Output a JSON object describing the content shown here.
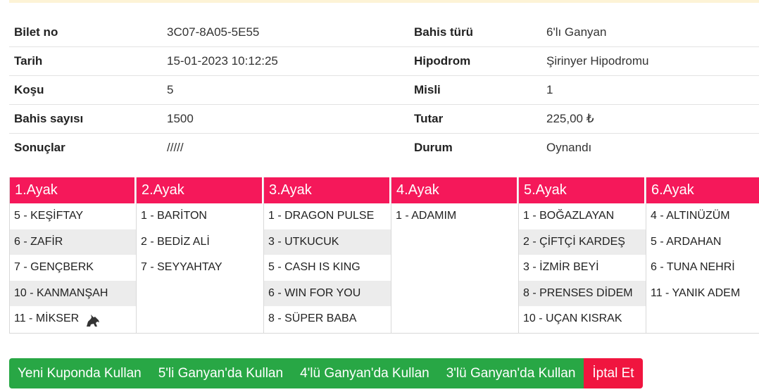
{
  "ticket": {
    "rows": [
      {
        "label1": "Bilet no",
        "value1": "3C07-8A05-5E55",
        "label2": "Bahis türü",
        "value2": "6'lı Ganyan"
      },
      {
        "label1": "Tarih",
        "value1": "15-01-2023 10:12:25",
        "label2": "Hipodrom",
        "value2": "Şirinyer Hipodromu"
      },
      {
        "label1": "Koşu",
        "value1": "5",
        "label2": "Misli",
        "value2": "1"
      },
      {
        "label1": "Bahis sayısı",
        "value1": "1500",
        "label2": "Tutar",
        "value2": "225,00 ₺"
      },
      {
        "label1": "Sonuçlar",
        "value1": "/////",
        "label2": "Durum",
        "value2": "Oynandı"
      }
    ]
  },
  "legs": [
    {
      "title": "1.Ayak",
      "items": [
        "5 - KEŞİFTAY",
        "6 - ZAFİR",
        "7 - GENÇBERK",
        "10 - KANMANŞAH",
        "11 - MİKSER"
      ]
    },
    {
      "title": "2.Ayak",
      "items": [
        "1 - BARİTON",
        "2 - BEDİZ ALİ",
        "7 - SEYYAHTAY"
      ]
    },
    {
      "title": "3.Ayak",
      "items": [
        "1 - DRAGON PULSE",
        "3 - UTKUCUK",
        "5 - CASH IS KING",
        "6 - WIN FOR YOU",
        "8 - SÜPER BABA"
      ]
    },
    {
      "title": "4.Ayak",
      "items": [
        "1 - ADAMIM"
      ]
    },
    {
      "title": "5.Ayak",
      "items": [
        "1 - BOĞAZLAYAN",
        "2 - ÇİFTÇİ KARDEŞ",
        "3 - İZMİR BEYİ",
        "8 - PRENSES DİDEM",
        "10 - UÇAN KISRAK"
      ]
    },
    {
      "title": "6.Ayak",
      "items": [
        "4 - ALTINÜZÜM",
        "5 - ARDAHAN",
        "6 - TUNA NEHRİ",
        "11 - YANIK ADEM"
      ]
    }
  ],
  "horse_icon": "horse-icon",
  "actions": {
    "new_coupon": "Yeni Kuponda Kullan",
    "five_ganyan": "5'li Ganyan'da Kullan",
    "four_ganyan": "4'lü Ganyan'da Kullan",
    "three_ganyan": "3'lü Ganyan'da Kullan",
    "cancel": "İptal Et"
  },
  "colors": {
    "accent": "#f5185a",
    "green": "#28a745",
    "red": "#f0153f"
  }
}
